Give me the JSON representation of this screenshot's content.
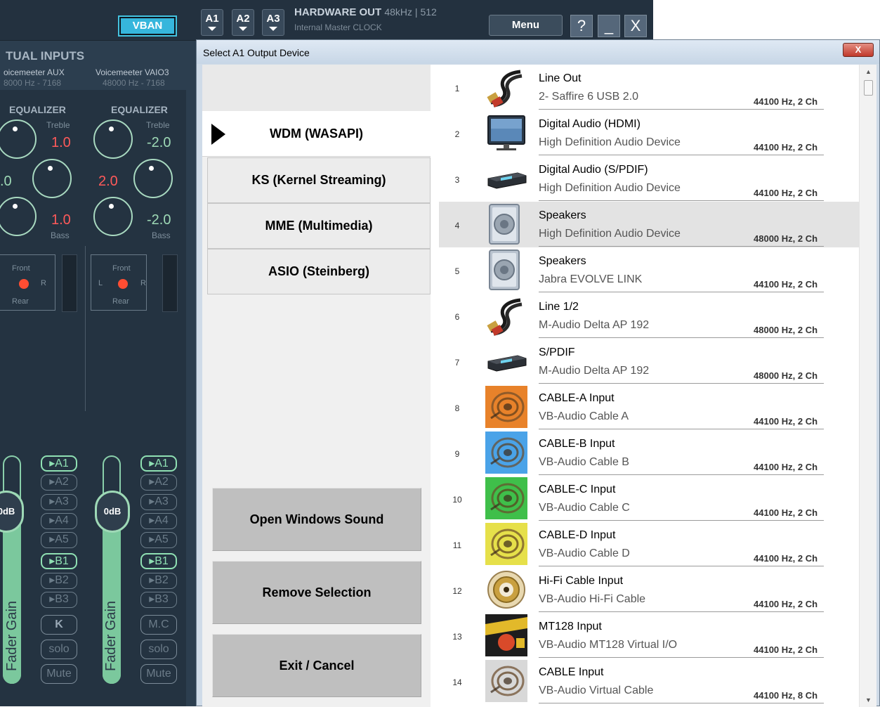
{
  "app": {
    "vban_label": "VBAN",
    "bus_buttons": [
      "A1",
      "A2",
      "A3"
    ],
    "hw_title": "HARDWARE OUT",
    "hw_rate": "48kHz | 512",
    "hw_clock": "Internal Master CLOCK",
    "menu_label": "Menu",
    "help_label": "?",
    "minimize_label": "_",
    "close_label": "X",
    "virtual_inputs_title": "TUAL INPUTS",
    "strips": [
      {
        "name": "oicemeeter AUX",
        "rate": "8000 Hz - 7168",
        "eq_label": "EQUALIZER",
        "treble_label": "Treble",
        "treble_value": "1.0",
        "mid_value": ".0",
        "bass_value": "1.0",
        "bass_label": "Bass",
        "pan_front": "Front",
        "pan_left": "",
        "pan_right": "R",
        "pan_rear": "Rear",
        "fader_value": "0dB",
        "fader_label": "Fader Gain",
        "buses": [
          "A1",
          "A2",
          "A3",
          "A4",
          "A5",
          "B1",
          "B2",
          "B3"
        ],
        "k_label": "K",
        "solo_label": "solo",
        "mute_label": "Mute"
      },
      {
        "name": "Voicemeeter VAIO3",
        "rate": "48000 Hz - 7168",
        "eq_label": "EQUALIZER",
        "treble_label": "Treble",
        "treble_value": "-2.0",
        "mid_value": "2.0",
        "bass_value": "-2.0",
        "bass_label": "Bass",
        "pan_front": "Front",
        "pan_left": "L",
        "pan_right": "R",
        "pan_rear": "Rear",
        "fader_value": "0dB",
        "fader_label": "Fader Gain",
        "buses": [
          "A1",
          "A2",
          "A3",
          "A4",
          "A5",
          "B1",
          "B2",
          "B3"
        ],
        "k_label": "M.C",
        "solo_label": "solo",
        "mute_label": "Mute"
      }
    ],
    "colors": {
      "accent": "#36b6dc",
      "fader": "#7bc89d",
      "knob_value": "#ff5a5a"
    }
  },
  "dialog": {
    "title": "Select A1 Output Device",
    "close_label": "X",
    "driver_tabs": [
      {
        "label": "WDM (WASAPI)",
        "active": true
      },
      {
        "label": "KS (Kernel Streaming)",
        "active": false
      },
      {
        "label": "MME (Multimedia)",
        "active": false
      },
      {
        "label": "ASIO (Steinberg)",
        "active": false
      }
    ],
    "actions": {
      "open_sound": "Open Windows Sound",
      "remove_selection": "Remove Selection",
      "exit_cancel": "Exit / Cancel"
    },
    "devices": [
      {
        "num": "1",
        "name": "Line Out",
        "sub": "2- Saffire 6 USB 2.0",
        "rate": "44100 Hz, 2 Ch",
        "icon": "rca-cable-icon"
      },
      {
        "num": "2",
        "name": "Digital Audio (HDMI)",
        "sub": "High Definition Audio Device",
        "rate": "44100 Hz, 2 Ch",
        "icon": "monitor-icon"
      },
      {
        "num": "3",
        "name": "Digital Audio (S/PDIF)",
        "sub": "High Definition Audio Device",
        "rate": "44100 Hz, 2 Ch",
        "icon": "receiver-icon"
      },
      {
        "num": "4",
        "name": "Speakers",
        "sub": "High Definition Audio Device",
        "rate": "48000 Hz, 2 Ch",
        "icon": "speaker-icon",
        "selected": true
      },
      {
        "num": "5",
        "name": "Speakers",
        "sub": "Jabra EVOLVE LINK",
        "rate": "44100 Hz, 2 Ch",
        "icon": "speaker-icon"
      },
      {
        "num": "6",
        "name": "Line 1/2",
        "sub": "M-Audio Delta AP 192",
        "rate": "48000 Hz, 2 Ch",
        "icon": "rca-cable-icon"
      },
      {
        "num": "7",
        "name": "S/PDIF",
        "sub": "M-Audio Delta AP 192",
        "rate": "48000 Hz, 2 Ch",
        "icon": "receiver-icon"
      },
      {
        "num": "8",
        "name": "CABLE-A Input",
        "sub": "VB-Audio Cable A",
        "rate": "44100 Hz, 2 Ch",
        "icon": "cable-reel-icon",
        "color": "#e8822a"
      },
      {
        "num": "9",
        "name": "CABLE-B Input",
        "sub": "VB-Audio Cable B",
        "rate": "44100 Hz, 2 Ch",
        "icon": "cable-reel-icon",
        "color": "#4aa3e8"
      },
      {
        "num": "10",
        "name": "CABLE-C Input",
        "sub": "VB-Audio Cable C",
        "rate": "44100 Hz, 2 Ch",
        "icon": "cable-reel-icon",
        "color": "#3fbf4a"
      },
      {
        "num": "11",
        "name": "CABLE-D Input",
        "sub": "VB-Audio Cable D",
        "rate": "44100 Hz, 2 Ch",
        "icon": "cable-reel-icon",
        "color": "#e6e04a"
      },
      {
        "num": "12",
        "name": "Hi-Fi Cable Input",
        "sub": "VB-Audio Hi-Fi Cable",
        "rate": "44100 Hz, 2 Ch",
        "icon": "rca-jack-icon"
      },
      {
        "num": "13",
        "name": "MT128 Input",
        "sub": "VB-Audio MT128 Virtual I/O",
        "rate": "44100 Hz, 2 Ch",
        "icon": "mt128-icon"
      },
      {
        "num": "14",
        "name": "CABLE Input",
        "sub": "VB-Audio Virtual Cable",
        "rate": "44100 Hz, 8 Ch",
        "icon": "cable-reel-icon",
        "color": "#d8d8d8"
      }
    ],
    "scroll_up": "▲",
    "scroll_down": "▼"
  }
}
